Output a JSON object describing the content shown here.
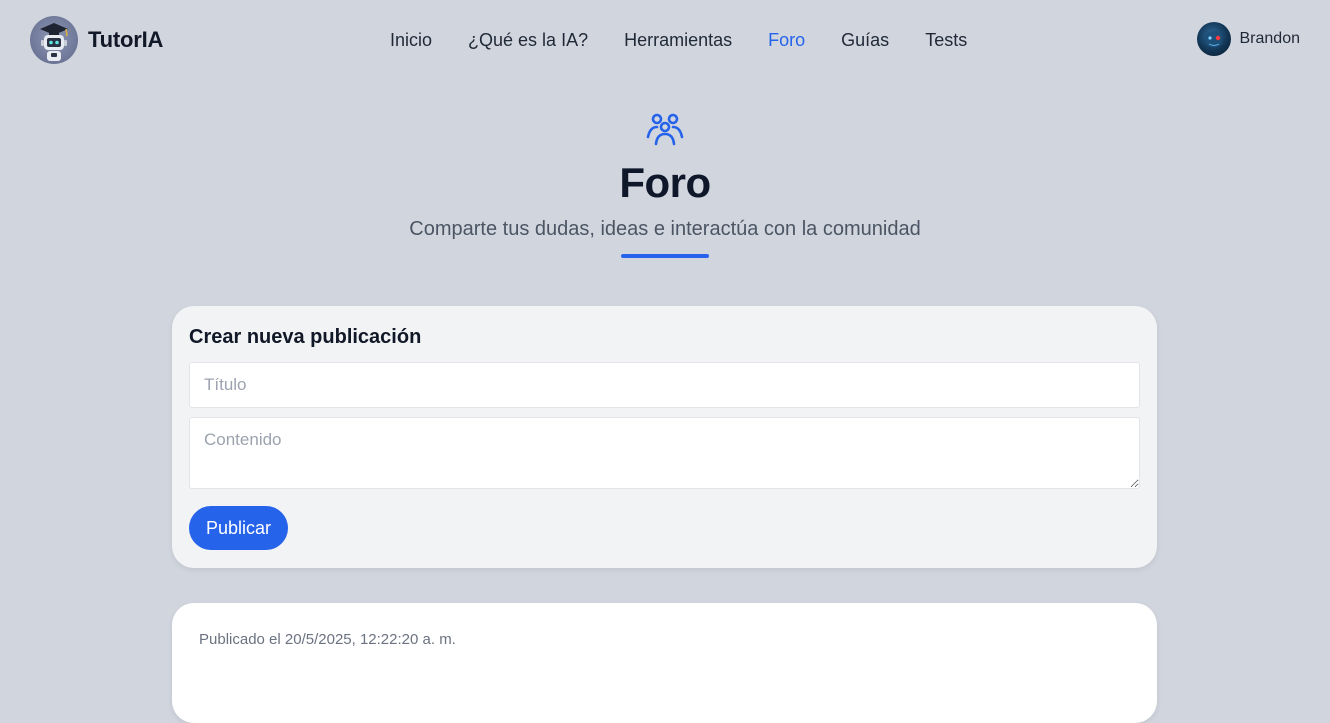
{
  "brand": {
    "name": "TutorIA"
  },
  "nav": {
    "links": [
      {
        "label": "Inicio",
        "active": false
      },
      {
        "label": "¿Qué es la IA?",
        "active": false
      },
      {
        "label": "Herramientas",
        "active": false
      },
      {
        "label": "Foro",
        "active": true
      },
      {
        "label": "Guías",
        "active": false
      },
      {
        "label": "Tests",
        "active": false
      }
    ]
  },
  "user": {
    "name": "Brandon"
  },
  "hero": {
    "icon": "users-group-icon",
    "title": "Foro",
    "subtitle": "Comparte tus dudas, ideas e interactúa con la comunidad"
  },
  "create_post": {
    "heading": "Crear nueva publicación",
    "title_placeholder": "Título",
    "title_value": "",
    "content_placeholder": "Contenido",
    "content_value": "",
    "submit_label": "Publicar"
  },
  "posts": [
    {
      "meta": "Publicado el 20/5/2025, 12:22:20 a. m."
    }
  ],
  "colors": {
    "background": "#d1d5de",
    "accent": "#2563eb",
    "card": "#f2f3f5"
  }
}
